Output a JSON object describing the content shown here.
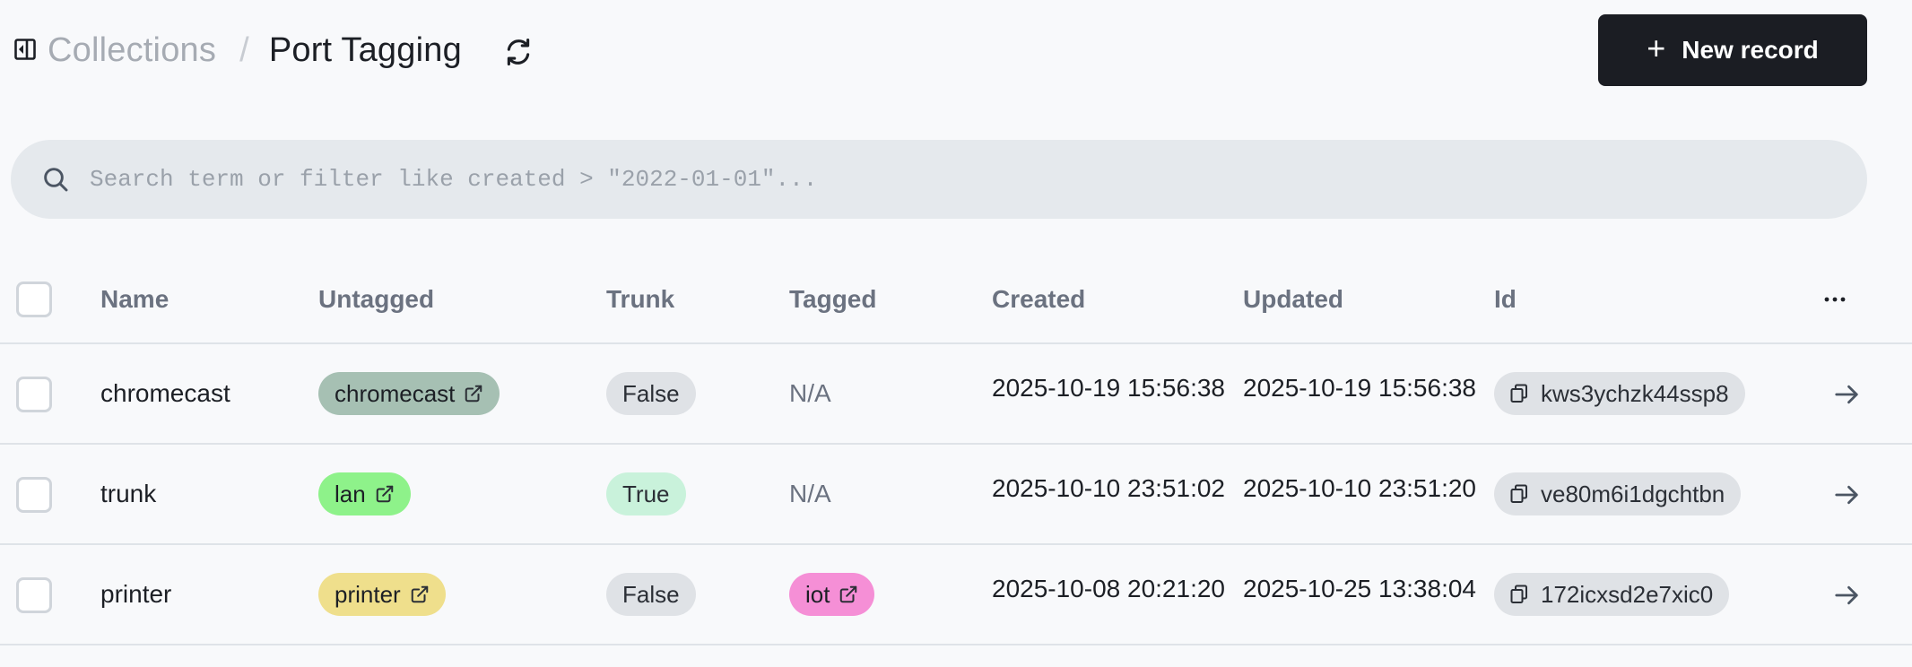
{
  "header": {
    "breadcrumb_parent": "Collections",
    "breadcrumb_separator": "/",
    "breadcrumb_current": "Port Tagging",
    "new_record_plus": "+",
    "new_record_label": "New record"
  },
  "search": {
    "placeholder": "Search term or filter like created > \"2022-01-01\"...",
    "value": ""
  },
  "table": {
    "columns": [
      "Name",
      "Untagged",
      "Trunk",
      "Tagged",
      "Created",
      "Updated",
      "Id"
    ],
    "more_label": "...",
    "rows": [
      {
        "name": "chromecast",
        "untagged": {
          "label": "chromecast",
          "color": "#a6c0b3"
        },
        "trunk": {
          "label": "False",
          "color": "#dfe2e6"
        },
        "tagged": {
          "label": "N/A"
        },
        "created": "2025-10-19 15:56:38",
        "updated": "2025-10-19 15:56:38",
        "id": "kws3ychzk44ssp8"
      },
      {
        "name": "trunk",
        "untagged": {
          "label": "lan",
          "color": "#8ef28a"
        },
        "trunk": {
          "label": "True",
          "color": "#c9f2db"
        },
        "tagged": {
          "label": "N/A"
        },
        "created": "2025-10-10 23:51:02",
        "updated": "2025-10-10 23:51:20",
        "id": "ve80m6i1dgchtbn"
      },
      {
        "name": "printer",
        "untagged": {
          "label": "printer",
          "color": "#efdf8c"
        },
        "trunk": {
          "label": "False",
          "color": "#dfe2e6"
        },
        "tagged": {
          "label": "iot",
          "color": "#f58fd6"
        },
        "created": "2025-10-08 20:21:20",
        "updated": "2025-10-25 13:38:04",
        "id": "172icxsd2e7xic0"
      }
    ]
  }
}
